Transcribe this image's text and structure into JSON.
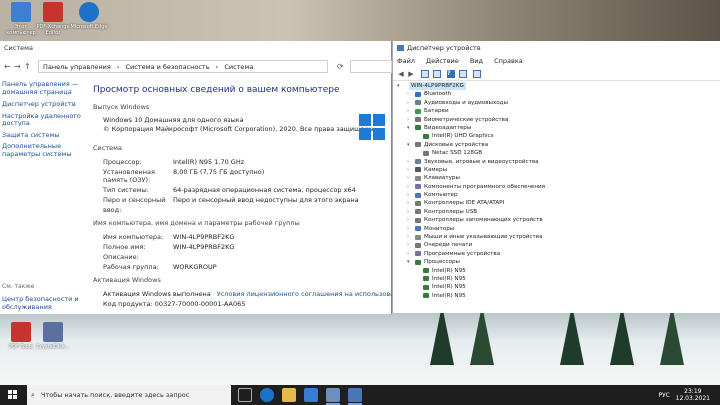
{
  "desktop": {
    "icons": [
      {
        "label": "Этот компьютер",
        "color": "#3c7fd4"
      },
      {
        "label": "PDF-Xchange Editor",
        "color": "#c7342e"
      },
      {
        "label": "Microsoft Edge",
        "color": "#1b72c8"
      },
      {
        "label": "PDF Tools",
        "color": "#c7342e"
      },
      {
        "label": "CrystalDisk...",
        "color": "#5b6fa0"
      }
    ]
  },
  "system_window": {
    "title": "Система",
    "breadcrumb": [
      "Панель управления",
      "›",
      "Система и безопасность",
      "›",
      "Система"
    ],
    "sidebar": {
      "home_link": "Панель управления — домашняя страница",
      "links": [
        "Диспетчер устройств",
        "Настройка удаленного доступа",
        "Защита системы",
        "Дополнительные параметры системы"
      ],
      "see_also": "См. также",
      "bottom_link": "Центр безопасности и обслуживания"
    },
    "heading": "Просмотр основных сведений о вашем компьютере",
    "edition": {
      "title": "Выпуск Windows",
      "name": "Windows 10 Домашняя для одного языка",
      "copyright": "© Корпорация Майкрософт (Microsoft Corporation), 2020. Все права защищены."
    },
    "system": {
      "title": "Система",
      "rows": [
        {
          "label": "Процессор:",
          "value": "Intel(R) N95   1.70 GHz"
        },
        {
          "label": "Установленная память (ОЗУ):",
          "value": "8,00 ГБ (7,75 ГБ доступно)"
        },
        {
          "label": "Тип системы:",
          "value": "64-разрядная операционная система, процессор x64"
        },
        {
          "label": "Перо и сенсорный ввод:",
          "value": "Перо и сенсорный ввод недоступны для этого экрана"
        }
      ]
    },
    "computer_name": {
      "title": "Имя компьютера, имя домена и параметры рабочей группы",
      "rows": [
        {
          "label": "Имя компьютера:",
          "value": "WIN-4LP9PRBF2KG"
        },
        {
          "label": "Полное имя:",
          "value": "WIN-4LP9PRBF2KG"
        },
        {
          "label": "Описание:",
          "value": ""
        },
        {
          "label": "Рабочая группа:",
          "value": "WORKGROUP"
        }
      ]
    },
    "activation": {
      "title": "Активация Windows",
      "status": "Активация Windows выполнена",
      "link": "Условия лицензионного соглашения на использование программного обеспече",
      "product_key": "Код продукта: 00327-70000-00001-AA065"
    }
  },
  "device_manager": {
    "title": "Диспетчер устройств",
    "menu": [
      "Файл",
      "Действие",
      "Вид",
      "Справка"
    ],
    "root": "WIN-4LP9PRBF2KG",
    "tree": [
      {
        "label": "Bluetooth",
        "level": 1,
        "expanded": false,
        "color": "#2a6fd1"
      },
      {
        "label": "Аудиовходы и аудиовыходы",
        "level": 1,
        "expanded": false,
        "color": "#6a7f95"
      },
      {
        "label": "Батареи",
        "level": 1,
        "expanded": false,
        "color": "#3a9a4a"
      },
      {
        "label": "Биометрические устройства",
        "level": 1,
        "expanded": false,
        "color": "#777"
      },
      {
        "label": "Видеоадаптеры",
        "level": 1,
        "expanded": true,
        "color": "#3b7a3b"
      },
      {
        "label": "Intel(R) UHD Graphics",
        "level": 2,
        "color": "#3b7a3b"
      },
      {
        "label": "Дисковые устройства",
        "level": 1,
        "expanded": true,
        "color": "#777"
      },
      {
        "label": "Netac SSD 128GB",
        "level": 2,
        "color": "#777"
      },
      {
        "label": "Звуковые, игровые и видеоустройства",
        "level": 1,
        "expanded": false,
        "color": "#6a7f95"
      },
      {
        "label": "Камеры",
        "level": 1,
        "expanded": false,
        "color": "#555"
      },
      {
        "label": "Клавиатуры",
        "level": 1,
        "expanded": false,
        "color": "#888"
      },
      {
        "label": "Компоненты программного обеспечения",
        "level": 1,
        "expanded": false,
        "color": "#7a6fa8"
      },
      {
        "label": "Компьютер",
        "level": 1,
        "expanded": false,
        "color": "#4a78b5"
      },
      {
        "label": "Контроллеры IDE ATA/ATAPI",
        "level": 1,
        "expanded": false,
        "color": "#777"
      },
      {
        "label": "Контроллеры USB",
        "level": 1,
        "expanded": false,
        "color": "#777"
      },
      {
        "label": "Контроллеры запоминающих устройств",
        "level": 1,
        "expanded": false,
        "color": "#777"
      },
      {
        "label": "Мониторы",
        "level": 1,
        "expanded": false,
        "color": "#4a78b5"
      },
      {
        "label": "Мыши и иные указывающие устройства",
        "level": 1,
        "expanded": false,
        "color": "#888"
      },
      {
        "label": "Очереди печати",
        "level": 1,
        "expanded": false,
        "color": "#777"
      },
      {
        "label": "Программные устройства",
        "level": 1,
        "expanded": false,
        "color": "#7a6fa8"
      },
      {
        "label": "Процессоры",
        "level": 1,
        "expanded": true,
        "color": "#3b7a3b"
      },
      {
        "label": "Intel(R) N95",
        "level": 2,
        "color": "#3b7a3b"
      },
      {
        "label": "Intel(R) N95",
        "level": 2,
        "color": "#3b7a3b"
      },
      {
        "label": "Intel(R) N95",
        "level": 2,
        "color": "#3b7a3b"
      },
      {
        "label": "Intel(R) N95",
        "level": 2,
        "color": "#3b7a3b"
      }
    ]
  },
  "taskbar": {
    "search_placeholder": "Чтобы начать поиск, введите здесь запрос",
    "lang": "РУС",
    "time": "23:19",
    "date": "12.03.2021"
  }
}
